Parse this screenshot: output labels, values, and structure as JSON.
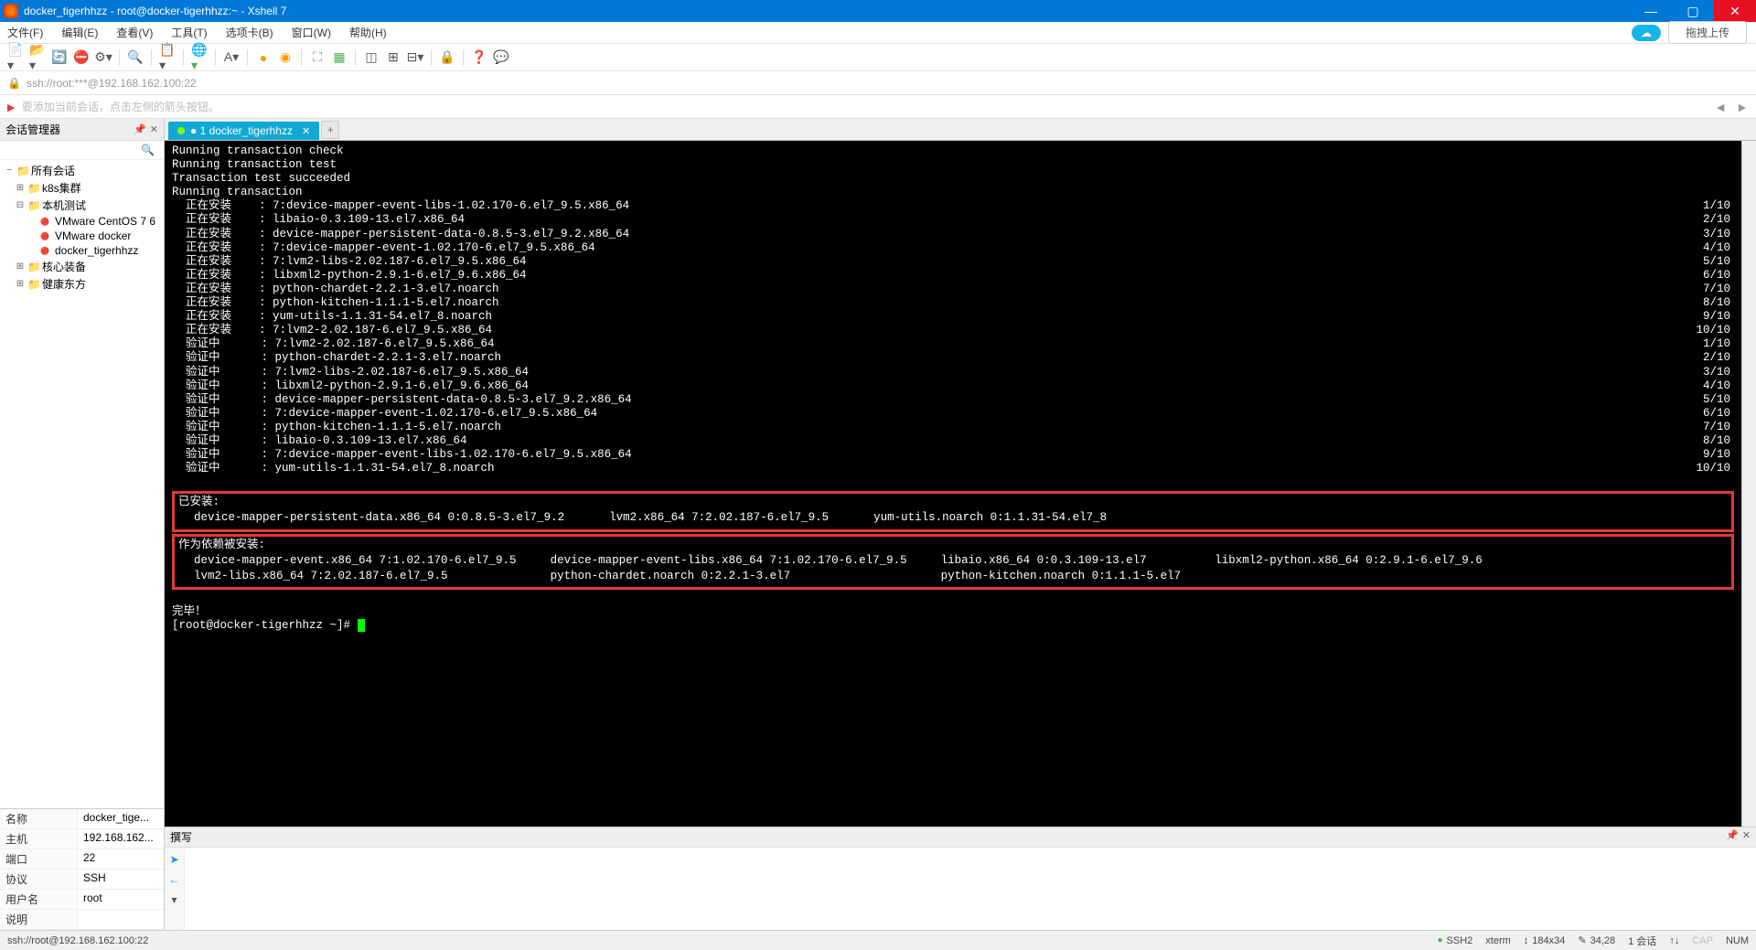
{
  "title": "docker_tigerhhzz - root@docker-tigerhhzz:~ - Xshell 7",
  "menus": [
    "文件(F)",
    "编辑(E)",
    "查看(V)",
    "工具(T)",
    "选项卡(B)",
    "窗口(W)",
    "帮助(H)"
  ],
  "upload_btn": "拖拽上传",
  "address": "ssh://root:***@192.168.162.100:22",
  "add_hint": "要添加当前会话，点击左侧的箭头按钮。",
  "session_panel": {
    "title": "会话管理器"
  },
  "tree": {
    "root": "所有会话",
    "items": [
      {
        "label": "k8s集群",
        "type": "folder",
        "depth": 1,
        "toggle": "+"
      },
      {
        "label": "本机测试",
        "type": "folder",
        "depth": 1,
        "toggle": "-"
      },
      {
        "label": "VMware CentOS 7 6",
        "type": "conn",
        "depth": 2
      },
      {
        "label": "VMware docker",
        "type": "conn",
        "depth": 2
      },
      {
        "label": "docker_tigerhhzz",
        "type": "conn",
        "depth": 2
      },
      {
        "label": "核心装备",
        "type": "folder",
        "depth": 1,
        "toggle": "+"
      },
      {
        "label": "健康东方",
        "type": "folder",
        "depth": 1,
        "toggle": "+"
      }
    ]
  },
  "props": [
    {
      "k": "名称",
      "v": "docker_tige..."
    },
    {
      "k": "主机",
      "v": "192.168.162..."
    },
    {
      "k": "端口",
      "v": "22"
    },
    {
      "k": "协议",
      "v": "SSH"
    },
    {
      "k": "用户名",
      "v": "root"
    },
    {
      "k": "说明",
      "v": ""
    }
  ],
  "tab_label": "1 docker_tigerhhzz",
  "terminal": {
    "header": [
      "Running transaction check",
      "Running transaction test",
      "Transaction test succeeded",
      "Running transaction"
    ],
    "install_rows": [
      {
        "l": "  正在安装    : 7:device-mapper-event-libs-1.02.170-6.el7_9.5.x86_64",
        "r": "1/10"
      },
      {
        "l": "  正在安装    : libaio-0.3.109-13.el7.x86_64",
        "r": "2/10"
      },
      {
        "l": "  正在安装    : device-mapper-persistent-data-0.8.5-3.el7_9.2.x86_64",
        "r": "3/10"
      },
      {
        "l": "  正在安装    : 7:device-mapper-event-1.02.170-6.el7_9.5.x86_64",
        "r": "4/10"
      },
      {
        "l": "  正在安装    : 7:lvm2-libs-2.02.187-6.el7_9.5.x86_64",
        "r": "5/10"
      },
      {
        "l": "  正在安装    : libxml2-python-2.9.1-6.el7_9.6.x86_64",
        "r": "6/10"
      },
      {
        "l": "  正在安装    : python-chardet-2.2.1-3.el7.noarch",
        "r": "7/10"
      },
      {
        "l": "  正在安装    : python-kitchen-1.1.1-5.el7.noarch",
        "r": "8/10"
      },
      {
        "l": "  正在安装    : yum-utils-1.1.31-54.el7_8.noarch",
        "r": "9/10"
      },
      {
        "l": "  正在安装    : 7:lvm2-2.02.187-6.el7_9.5.x86_64",
        "r": "10/10"
      },
      {
        "l": "  验证中      : 7:lvm2-2.02.187-6.el7_9.5.x86_64",
        "r": "1/10"
      },
      {
        "l": "  验证中      : python-chardet-2.2.1-3.el7.noarch",
        "r": "2/10"
      },
      {
        "l": "  验证中      : 7:lvm2-libs-2.02.187-6.el7_9.5.x86_64",
        "r": "3/10"
      },
      {
        "l": "  验证中      : libxml2-python-2.9.1-6.el7_9.6.x86_64",
        "r": "4/10"
      },
      {
        "l": "  验证中      : device-mapper-persistent-data-0.8.5-3.el7_9.2.x86_64",
        "r": "5/10"
      },
      {
        "l": "  验证中      : 7:device-mapper-event-1.02.170-6.el7_9.5.x86_64",
        "r": "6/10"
      },
      {
        "l": "  验证中      : python-kitchen-1.1.1-5.el7.noarch",
        "r": "7/10"
      },
      {
        "l": "  验证中      : libaio-0.3.109-13.el7.x86_64",
        "r": "8/10"
      },
      {
        "l": "  验证中      : 7:device-mapper-event-libs-1.02.170-6.el7_9.5.x86_64",
        "r": "9/10"
      },
      {
        "l": "  验证中      : yum-utils-1.1.31-54.el7_8.noarch",
        "r": "10/10"
      }
    ],
    "installed_hdr": "已安装:",
    "installed": [
      "device-mapper-persistent-data.x86_64 0:0.8.5-3.el7_9.2",
      "lvm2.x86_64 7:2.02.187-6.el7_9.5",
      "yum-utils.noarch 0:1.1.31-54.el7_8"
    ],
    "deps_hdr": "作为依赖被安装:",
    "deps_row1": [
      "device-mapper-event.x86_64 7:1.02.170-6.el7_9.5",
      "device-mapper-event-libs.x86_64 7:1.02.170-6.el7_9.5",
      "libaio.x86_64 0:0.3.109-13.el7",
      "libxml2-python.x86_64 0:2.9.1-6.el7_9.6"
    ],
    "deps_row2": [
      "lvm2-libs.x86_64 7:2.02.187-6.el7_9.5",
      "python-chardet.noarch 0:2.2.1-3.el7",
      "python-kitchen.noarch 0:1.1.1-5.el7",
      ""
    ],
    "done": "完毕！",
    "prompt": "[root@docker-tigerhhzz ~]# "
  },
  "compose_title": "撰写",
  "status": {
    "left": "ssh://root@192.168.162.100:22",
    "ssh": "SSH2",
    "term": "xterm",
    "size": "184x34",
    "pos": "34,28",
    "sess": "1 会话",
    "cap": "CAP",
    "num": "NUM"
  }
}
